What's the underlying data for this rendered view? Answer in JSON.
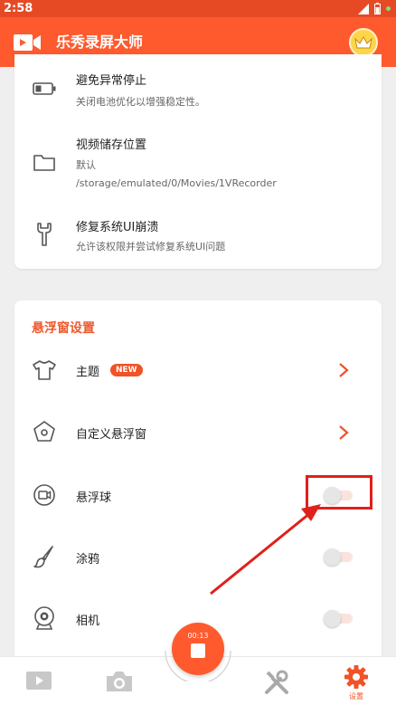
{
  "status_bar": {
    "time": "2:58"
  },
  "app_bar": {
    "title": "乐秀录屏大师",
    "logo_icon": "video-camera-icon",
    "vip_icon": "crown-icon"
  },
  "general_settings": {
    "items": [
      {
        "label": "避免异常停止",
        "sub": "关闭电池优化以增强稳定性。",
        "icon": "battery-icon"
      },
      {
        "label": "视频储存位置",
        "sub": "默认",
        "sub2": "/storage/emulated/0/Movies/1VRecorder",
        "icon": "folder-icon"
      },
      {
        "label": "修复系统UI崩溃",
        "sub": "允许该权限并尝试修复系统UI问题",
        "icon": "wrench-icon"
      }
    ]
  },
  "floating_settings": {
    "title": "悬浮窗设置",
    "items": [
      {
        "label": "主题",
        "badge": "NEW",
        "icon": "shirt-icon",
        "control": "chevron"
      },
      {
        "label": "自定义悬浮窗",
        "icon": "pentagon-icon",
        "control": "chevron"
      },
      {
        "label": "悬浮球",
        "icon": "camera-circle-icon",
        "control": "toggle",
        "value": false
      },
      {
        "label": "涂鸦",
        "icon": "brush-icon",
        "control": "toggle",
        "value": false
      },
      {
        "label": "相机",
        "icon": "webcam-icon",
        "control": "toggle",
        "value": false
      }
    ]
  },
  "record_button": {
    "time": "00:13"
  },
  "bottom_nav": {
    "tabs": [
      {
        "name": "video",
        "icon": "play-icon"
      },
      {
        "name": "camera",
        "icon": "camera-icon"
      },
      {
        "name": "tools",
        "icon": "tools-icon"
      },
      {
        "name": "settings",
        "icon": "gear-icon",
        "label": "设置",
        "active": true
      }
    ]
  },
  "colors": {
    "accent": "#ff5a2e",
    "highlight": "#e0201b"
  }
}
